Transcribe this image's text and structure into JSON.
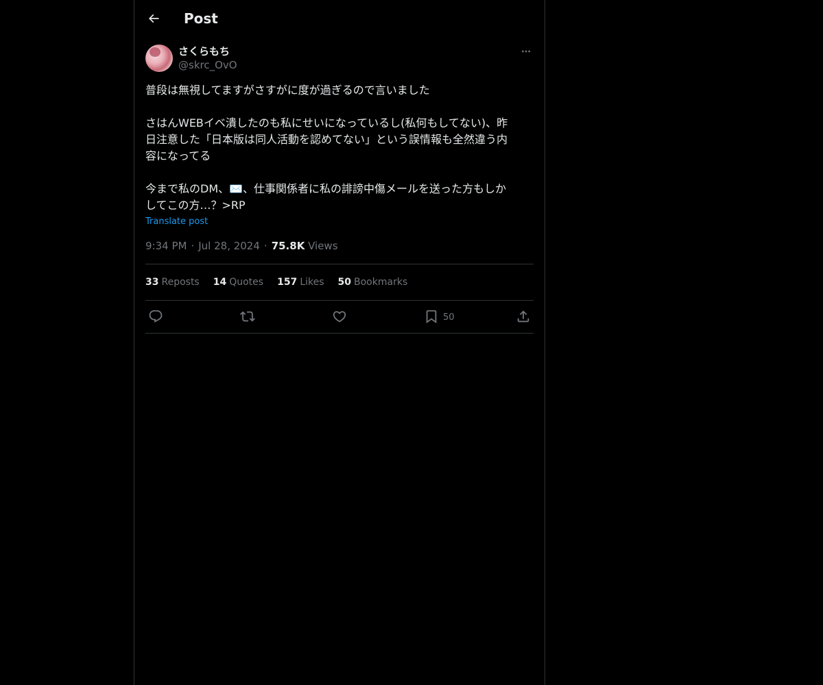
{
  "header": {
    "back_icon": "arrow-left-icon",
    "title": "Post"
  },
  "post": {
    "author": {
      "display_name": "さくらもち",
      "handle": "@skrc_OvO"
    },
    "more_icon": "more-horizontal-icon",
    "text": "普段は無視してますがさすがに度が過ぎるので言いました\n\nさはんWEBイベ潰したのも私にせいになっているし(私何もしてない)、昨\n日注意した「日本版は同人活動を認めてない」という誤情報も全然違う内\n容になってる\n\n今まで私のDM、✉️、仕事関係者に私の誹謗中傷メールを送った方もしか\nしてこの方…？>RP",
    "translate_label": "Translate post",
    "time": "9:34 PM",
    "date": "Jul 28, 2024",
    "views_count": "75.8K",
    "views_label": "Views"
  },
  "stats": [
    {
      "count": "33",
      "label": "Reposts"
    },
    {
      "count": "14",
      "label": "Quotes"
    },
    {
      "count": "157",
      "label": "Likes"
    },
    {
      "count": "50",
      "label": "Bookmarks"
    }
  ],
  "actions": {
    "reply_icon": "reply-icon",
    "repost_icon": "repost-icon",
    "like_icon": "heart-icon",
    "bookmark_icon": "bookmark-icon",
    "bookmark_count": "50",
    "share_icon": "share-icon"
  },
  "colors": {
    "background": "#000000",
    "text_primary": "#e7e9ea",
    "text_secondary": "#71767b",
    "accent": "#1d9bf0",
    "divider": "#2f3336"
  }
}
